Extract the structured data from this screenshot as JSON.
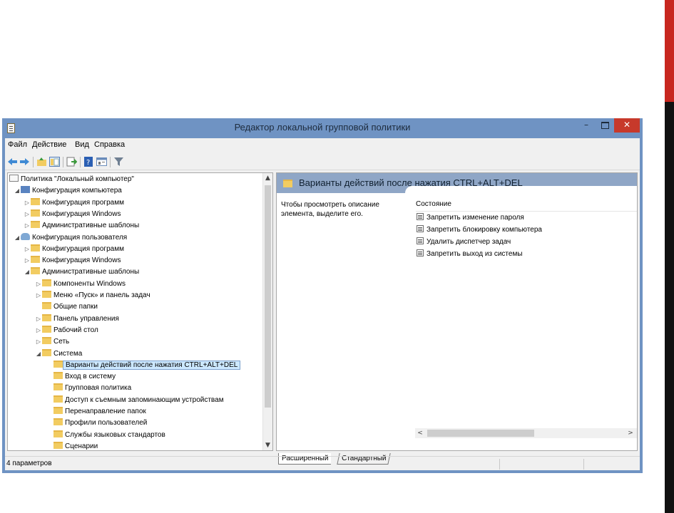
{
  "window": {
    "title": "Редактор локальной групповой политики",
    "minimize": "–",
    "close": "✕"
  },
  "menu": [
    "Файл",
    "Действие",
    "Вид",
    "Справка"
  ],
  "toolbar_icons": [
    "back-icon",
    "forward-icon",
    "up-folder-icon",
    "show-hide-tree-icon",
    "export-icon",
    "help-icon",
    "properties-icon",
    "filter-icon"
  ],
  "tree": [
    {
      "label": "Политика \"Локальный компьютер\"",
      "icon": "doc"
    },
    {
      "label": "Конфигурация компьютера",
      "icon": "comp",
      "arrow": "◢"
    },
    {
      "label": "Конфигурация программ",
      "icon": "folder",
      "arrow": "▷"
    },
    {
      "label": "Конфигурация Windows",
      "icon": "folder",
      "arrow": "▷"
    },
    {
      "label": "Административные шаблоны",
      "icon": "folder",
      "arrow": "▷"
    },
    {
      "label": "Конфигурация пользователя",
      "icon": "user",
      "arrow": "◢"
    },
    {
      "label": "Конфигурация программ",
      "icon": "folder",
      "arrow": "▷"
    },
    {
      "label": "Конфигурация Windows",
      "icon": "folder",
      "arrow": "▷"
    },
    {
      "label": "Административные шаблоны",
      "icon": "folder",
      "arrow": "◢"
    },
    {
      "label": "Компоненты Windows",
      "icon": "folder",
      "arrow": "▷"
    },
    {
      "label": "Меню «Пуск» и панель задач",
      "icon": "folder",
      "arrow": "▷"
    },
    {
      "label": "Общие папки",
      "icon": "folder",
      "arrow": ""
    },
    {
      "label": "Панель управления",
      "icon": "folder",
      "arrow": "▷"
    },
    {
      "label": "Рабочий стол",
      "icon": "folder",
      "arrow": "▷"
    },
    {
      "label": "Сеть",
      "icon": "folder",
      "arrow": "▷"
    },
    {
      "label": "Система",
      "icon": "folder",
      "arrow": "◢"
    },
    {
      "label": "Варианты действий после нажатия CTRL+ALT+DEL",
      "icon": "folder",
      "arrow": "",
      "selected": true
    },
    {
      "label": "Вход в систему",
      "icon": "folder",
      "arrow": ""
    },
    {
      "label": "Групповая политика",
      "icon": "folder",
      "arrow": ""
    },
    {
      "label": "Доступ к съемным запоминающим устройствам",
      "icon": "folder",
      "arrow": ""
    },
    {
      "label": "Перенаправление папок",
      "icon": "folder",
      "arrow": ""
    },
    {
      "label": "Профили пользователей",
      "icon": "folder",
      "arrow": ""
    },
    {
      "label": "Службы языковых стандартов",
      "icon": "folder",
      "arrow": ""
    },
    {
      "label": "Сценарии",
      "icon": "folder",
      "arrow": ""
    }
  ],
  "scroll_arrows": {
    "up": "▲",
    "down": "▼",
    "left": "<",
    "right": ">"
  },
  "pane": {
    "title": "Варианты действий после нажатия CTRL+ALT+DEL",
    "description": "Чтобы просмотреть описание элемента, выделите его.",
    "column_header": "Состояние",
    "items": [
      "Запретить изменение пароля",
      "Запретить блокировку компьютера",
      "Удалить диспетчер задач",
      "Запретить выход из системы"
    ]
  },
  "tabs": [
    "Расширенный",
    "Стандартный"
  ],
  "status": "4 параметров",
  "colors": {
    "titlebar": "#6f93c3",
    "close_button": "#c7392b",
    "pane_header": "#8fa6c6",
    "selection": "#cce8ff",
    "folder": "#f2cc61"
  }
}
